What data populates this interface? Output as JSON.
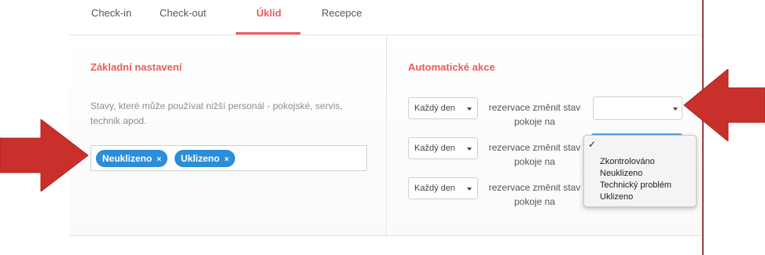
{
  "tabs": [
    {
      "label": "Check-in"
    },
    {
      "label": "Check-out"
    },
    {
      "label": "Úklid",
      "active": true
    },
    {
      "label": "Recepce"
    }
  ],
  "left": {
    "title": "Základní nastavení",
    "description": "Stavy, které může používat nižší personál - pokojské, servis, technik apod.",
    "tags": [
      {
        "label": "Neuklizeno",
        "remove": "×"
      },
      {
        "label": "Uklizeno",
        "remove": "×"
      }
    ]
  },
  "right": {
    "title": "Automatické akce",
    "rows": [
      {
        "frequency": "Každý den",
        "text_line1": "rezervace změnit stav",
        "text_line2": "pokoje na"
      },
      {
        "frequency": "Každý den",
        "text_line1": "rezervace změnit stav",
        "text_line2": "pokoje na"
      },
      {
        "frequency": "Každý den",
        "text_line1": "rezervace změnit stav",
        "text_line2": "pokoje na"
      }
    ],
    "status_select": {
      "value": ""
    },
    "dropdown": {
      "checkmark": "✓",
      "options": [
        "Zkontrolováno",
        "Neuklizeno",
        "Technický problém",
        "Uklizeno"
      ]
    }
  },
  "colors": {
    "accent": "#ef5a5a",
    "tag_bg": "#2c8dd8",
    "arrow": "#c9302c"
  }
}
